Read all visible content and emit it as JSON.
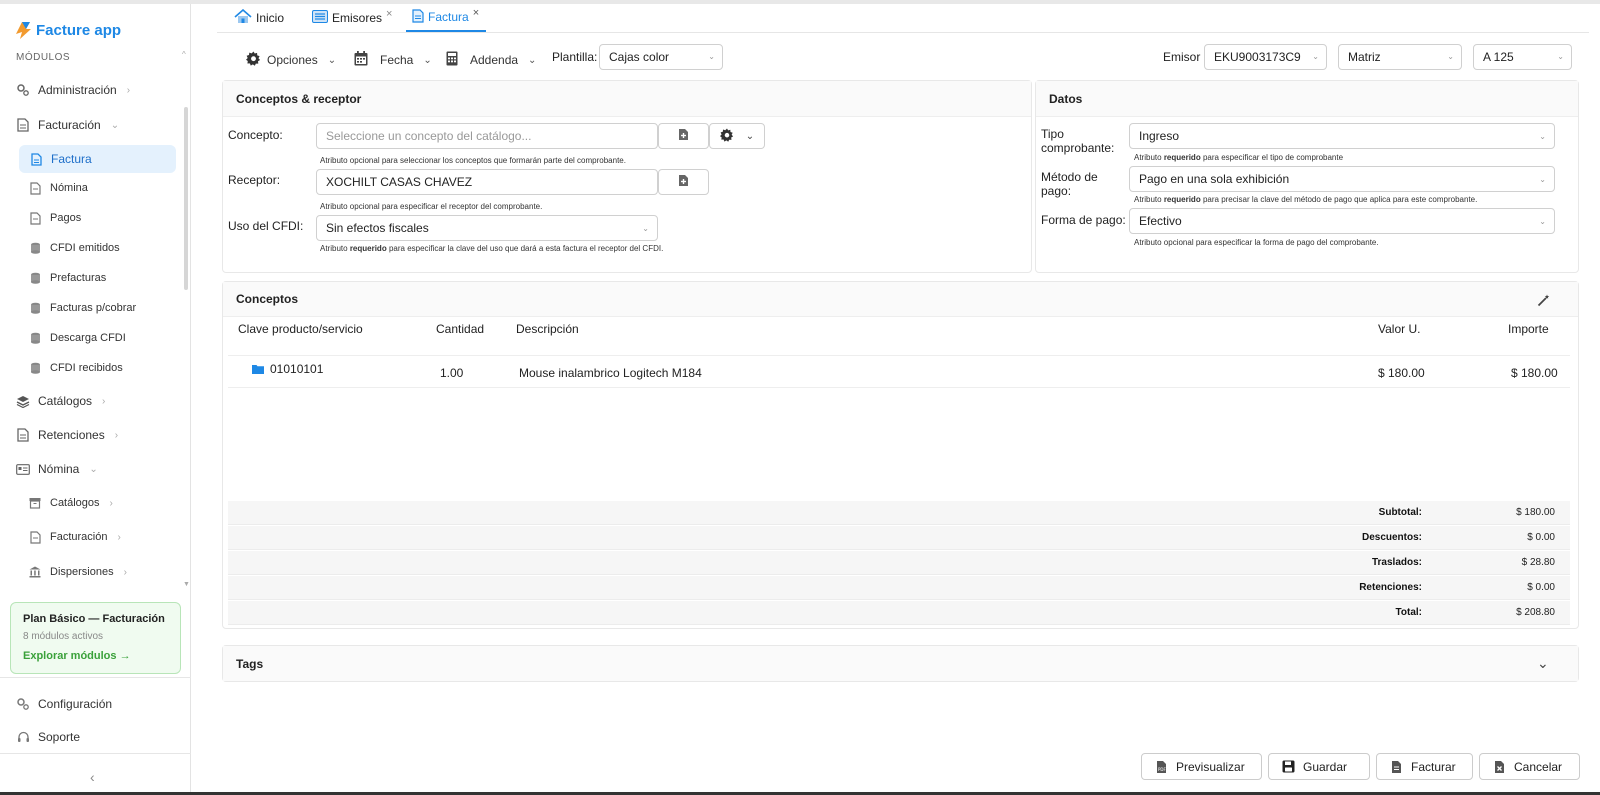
{
  "brand": {
    "name": "Facture app"
  },
  "sidebar": {
    "section_label": "MÓDULOS",
    "items": [
      {
        "label": "Administración",
        "icon": "gears-icon"
      },
      {
        "label": "Facturación",
        "icon": "document-icon"
      },
      {
        "label": "Factura",
        "icon": "invoice-icon"
      },
      {
        "label": "Nómina",
        "icon": "document-icon"
      },
      {
        "label": "Pagos",
        "icon": "document-icon"
      },
      {
        "label": "CFDI emitidos",
        "icon": "database-icon"
      },
      {
        "label": "Prefacturas",
        "icon": "database-icon"
      },
      {
        "label": "Facturas p/cobrar",
        "icon": "database-icon"
      },
      {
        "label": "Descarga CFDI",
        "icon": "database-icon"
      },
      {
        "label": "CFDI recibidos",
        "icon": "database-icon"
      },
      {
        "label": "Catálogos",
        "icon": "layers-icon"
      },
      {
        "label": "Retenciones",
        "icon": "document-icon"
      },
      {
        "label": "Nómina",
        "icon": "id-card-icon"
      },
      {
        "label": "Catálogos",
        "icon": "archive-icon"
      },
      {
        "label": "Facturación",
        "icon": "document-icon"
      },
      {
        "label": "Dispersiones",
        "icon": "bank-icon"
      }
    ],
    "plan": {
      "title": "Plan Básico — Facturación",
      "subtitle": "8 módulos activos",
      "link": "Explorar módulos →"
    },
    "footer": [
      {
        "label": "Configuración",
        "icon": "gears-icon"
      },
      {
        "label": "Soporte",
        "icon": "headset-icon"
      }
    ]
  },
  "tabs": [
    {
      "label": "Inicio",
      "icon": "home-icon"
    },
    {
      "label": "Emisores",
      "icon": "list-icon"
    },
    {
      "label": "Factura",
      "icon": "invoice-icon"
    }
  ],
  "toolbar": {
    "opciones": "Opciones",
    "fecha": "Fecha",
    "addenda": "Addenda",
    "plantilla_label": "Plantilla:",
    "plantilla_value": "Cajas color",
    "emisor_label": "Emisor",
    "emisor_value": "EKU9003173C9",
    "sucursal_value": "Matriz",
    "serie_value": "A 125"
  },
  "conceptos_receptor": {
    "title": "Conceptos & receptor",
    "concepto_label": "Concepto:",
    "concepto_placeholder": "Seleccione un concepto del catálogo...",
    "concepto_hint": "Atributo opcional para seleccionar los conceptos que formarán parte del comprobante.",
    "receptor_label": "Receptor:",
    "receptor_value": "XOCHILT CASAS CHAVEZ",
    "receptor_hint": "Atributo opcional para especificar el receptor del comprobante.",
    "uso_label": "Uso del CFDI:",
    "uso_value": "Sin efectos fiscales",
    "uso_hint_pre": "Atributo",
    "uso_hint_bold": "requerido",
    "uso_hint_post": "para especificar la clave del uso que dará a esta factura el receptor del CFDI."
  },
  "datos": {
    "title": "Datos",
    "tipo_label": "Tipo comprobante:",
    "tipo_value": "Ingreso",
    "tipo_hint_pre": "Atributo",
    "tipo_hint_bold": "requerido",
    "tipo_hint_post": "para especificar el tipo de comprobante",
    "metodo_label": "Método de pago:",
    "metodo_value": "Pago en una sola exhibición",
    "metodo_hint_pre": "Atributo",
    "metodo_hint_bold": "requerido",
    "metodo_hint_post": "para precisar la clave del método de pago que aplica para este comprobante.",
    "forma_label": "Forma de pago:",
    "forma_value": "Efectivo",
    "forma_hint": "Atributo opcional para especificar la forma de pago del comprobante."
  },
  "conceptos": {
    "title": "Conceptos",
    "columns": [
      "Clave producto/servicio",
      "Cantidad",
      "Descripción",
      "Valor U.",
      "Importe"
    ],
    "rows": [
      {
        "clave": "01010101",
        "cantidad": "1.00",
        "descripcion": "Mouse inalambrico Logitech M184",
        "valor": "$ 180.00",
        "importe": "$ 180.00"
      }
    ],
    "totals": [
      {
        "label": "Subtotal:",
        "value": "$ 180.00"
      },
      {
        "label": "Descuentos:",
        "value": "$ 0.00"
      },
      {
        "label": "Traslados:",
        "value": "$ 28.80"
      },
      {
        "label": "Retenciones:",
        "value": "$ 0.00"
      },
      {
        "label": "Total:",
        "value": "$ 208.80"
      }
    ]
  },
  "tags": {
    "title": "Tags"
  },
  "footer_buttons": {
    "previsualizar": "Previsualizar",
    "guardar": "Guardar",
    "facturar": "Facturar",
    "cancelar": "Cancelar"
  },
  "colors": {
    "accent": "#1e88e5",
    "active_bg": "#e4f1fd",
    "plan_green": "#3aa13a"
  }
}
